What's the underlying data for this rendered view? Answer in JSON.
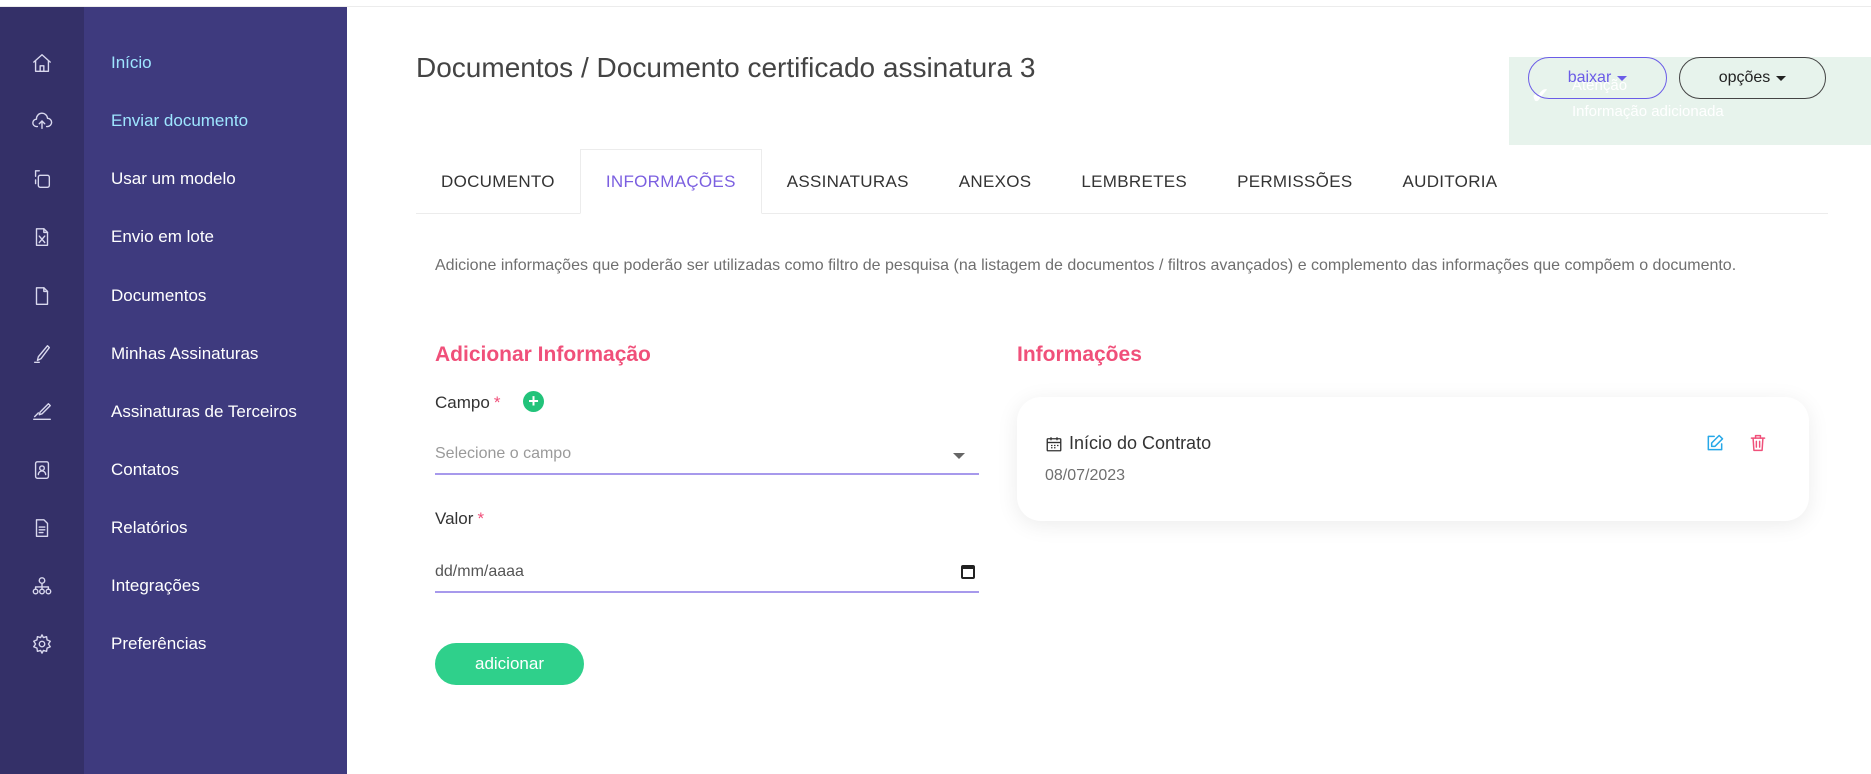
{
  "colors": {
    "sidebar_icon_bg": "#343068",
    "sidebar_label_bg": "#3e3a7e",
    "accent_purple": "#7b5fe0",
    "accent_pink": "#f0507a",
    "accent_green": "#2fd08b",
    "edit_blue": "#27a8e8"
  },
  "sidebar": {
    "items": [
      {
        "label": "Início",
        "icon": "home-icon",
        "active": true
      },
      {
        "label": "Enviar documento",
        "icon": "cloud-upload-icon",
        "active": true
      },
      {
        "label": "Usar um modelo",
        "icon": "template-icon",
        "active": false
      },
      {
        "label": "Envio em lote",
        "icon": "spreadsheet-icon",
        "active": false
      },
      {
        "label": "Documentos",
        "icon": "document-icon",
        "active": false
      },
      {
        "label": "Minhas Assinaturas",
        "icon": "pen-icon",
        "active": false
      },
      {
        "label": "Assinaturas de Terceiros",
        "icon": "signature-icon",
        "active": false
      },
      {
        "label": "Contatos",
        "icon": "contact-book-icon",
        "active": false
      },
      {
        "label": "Relatórios",
        "icon": "report-icon",
        "active": false
      },
      {
        "label": "Integrações",
        "icon": "integrations-icon",
        "active": false
      },
      {
        "label": "Preferências",
        "icon": "gear-icon",
        "active": false
      }
    ]
  },
  "header": {
    "title": "Documentos / Documento certificado assinatura 3",
    "download_label": "baixar",
    "options_label": "opções"
  },
  "toast": {
    "title": "Atenção",
    "message": "Informação adicionada",
    "icon": "check-icon"
  },
  "tabs": [
    {
      "label": "DOCUMENTO",
      "active": false
    },
    {
      "label": "INFORMAÇÕES",
      "active": true
    },
    {
      "label": "ASSINATURAS",
      "active": false
    },
    {
      "label": "ANEXOS",
      "active": false
    },
    {
      "label": "LEMBRETES",
      "active": false
    },
    {
      "label": "PERMISSÕES",
      "active": false
    },
    {
      "label": "AUDITORIA",
      "active": false
    }
  ],
  "main": {
    "description": "Adicione informações que poderão ser utilizadas como filtro de pesquisa (na listagem de documentos / filtros avançados) e complemento das informações que compõem o documento.",
    "add_section": {
      "title": "Adicionar Informação",
      "field_label": "Campo",
      "field_placeholder": "Selecione o campo",
      "value_label": "Valor",
      "value_placeholder": "dd/mm/aaaa",
      "required_mark": "*",
      "add_button": "adicionar"
    },
    "info_section": {
      "title": "Informações",
      "items": [
        {
          "name": "Início do Contrato",
          "value": "08/07/2023",
          "icon": "calendar-icon"
        }
      ]
    }
  }
}
